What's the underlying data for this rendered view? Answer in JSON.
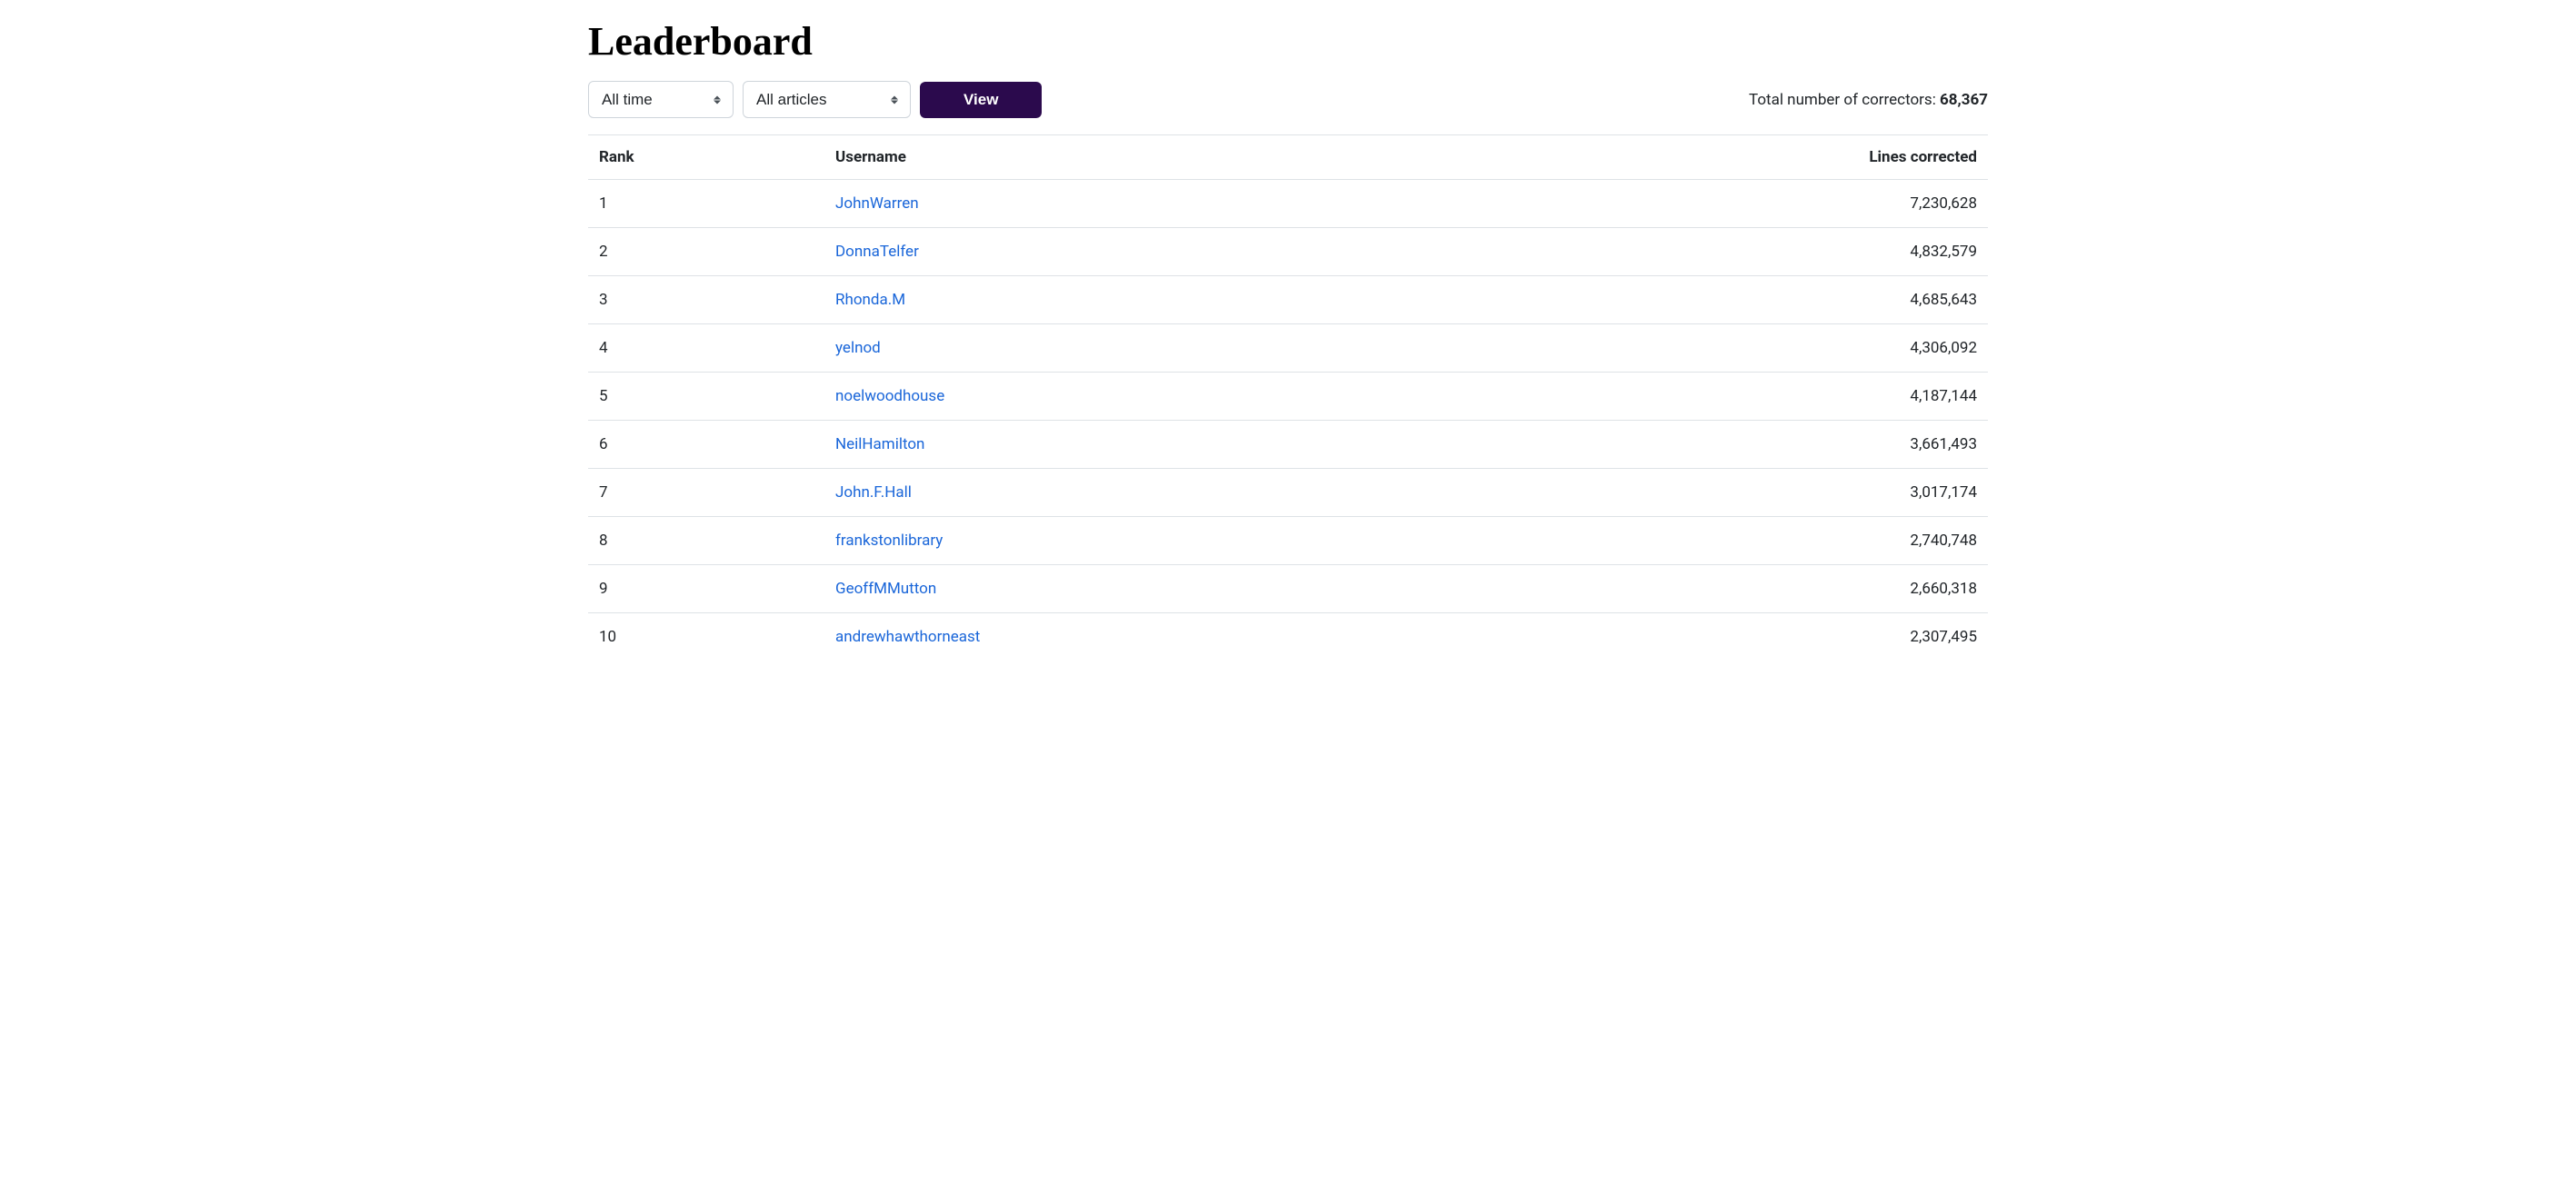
{
  "title": "Leaderboard",
  "filters": {
    "time": "All time",
    "scope": "All articles",
    "view_label": "View"
  },
  "total": {
    "label": "Total number of correctors: ",
    "count": "68,367"
  },
  "columns": {
    "rank": "Rank",
    "username": "Username",
    "lines": "Lines corrected"
  },
  "rows": [
    {
      "rank": "1",
      "username": "JohnWarren",
      "lines": "7,230,628"
    },
    {
      "rank": "2",
      "username": "DonnaTelfer",
      "lines": "4,832,579"
    },
    {
      "rank": "3",
      "username": "Rhonda.M",
      "lines": "4,685,643"
    },
    {
      "rank": "4",
      "username": "yelnod",
      "lines": "4,306,092"
    },
    {
      "rank": "5",
      "username": "noelwoodhouse",
      "lines": "4,187,144"
    },
    {
      "rank": "6",
      "username": "NeilHamilton",
      "lines": "3,661,493"
    },
    {
      "rank": "7",
      "username": "John.F.Hall",
      "lines": "3,017,174"
    },
    {
      "rank": "8",
      "username": "frankstonlibrary",
      "lines": "2,740,748"
    },
    {
      "rank": "9",
      "username": "GeoffMMutton",
      "lines": "2,660,318"
    },
    {
      "rank": "10",
      "username": "andrewhawthorneast",
      "lines": "2,307,495"
    }
  ]
}
